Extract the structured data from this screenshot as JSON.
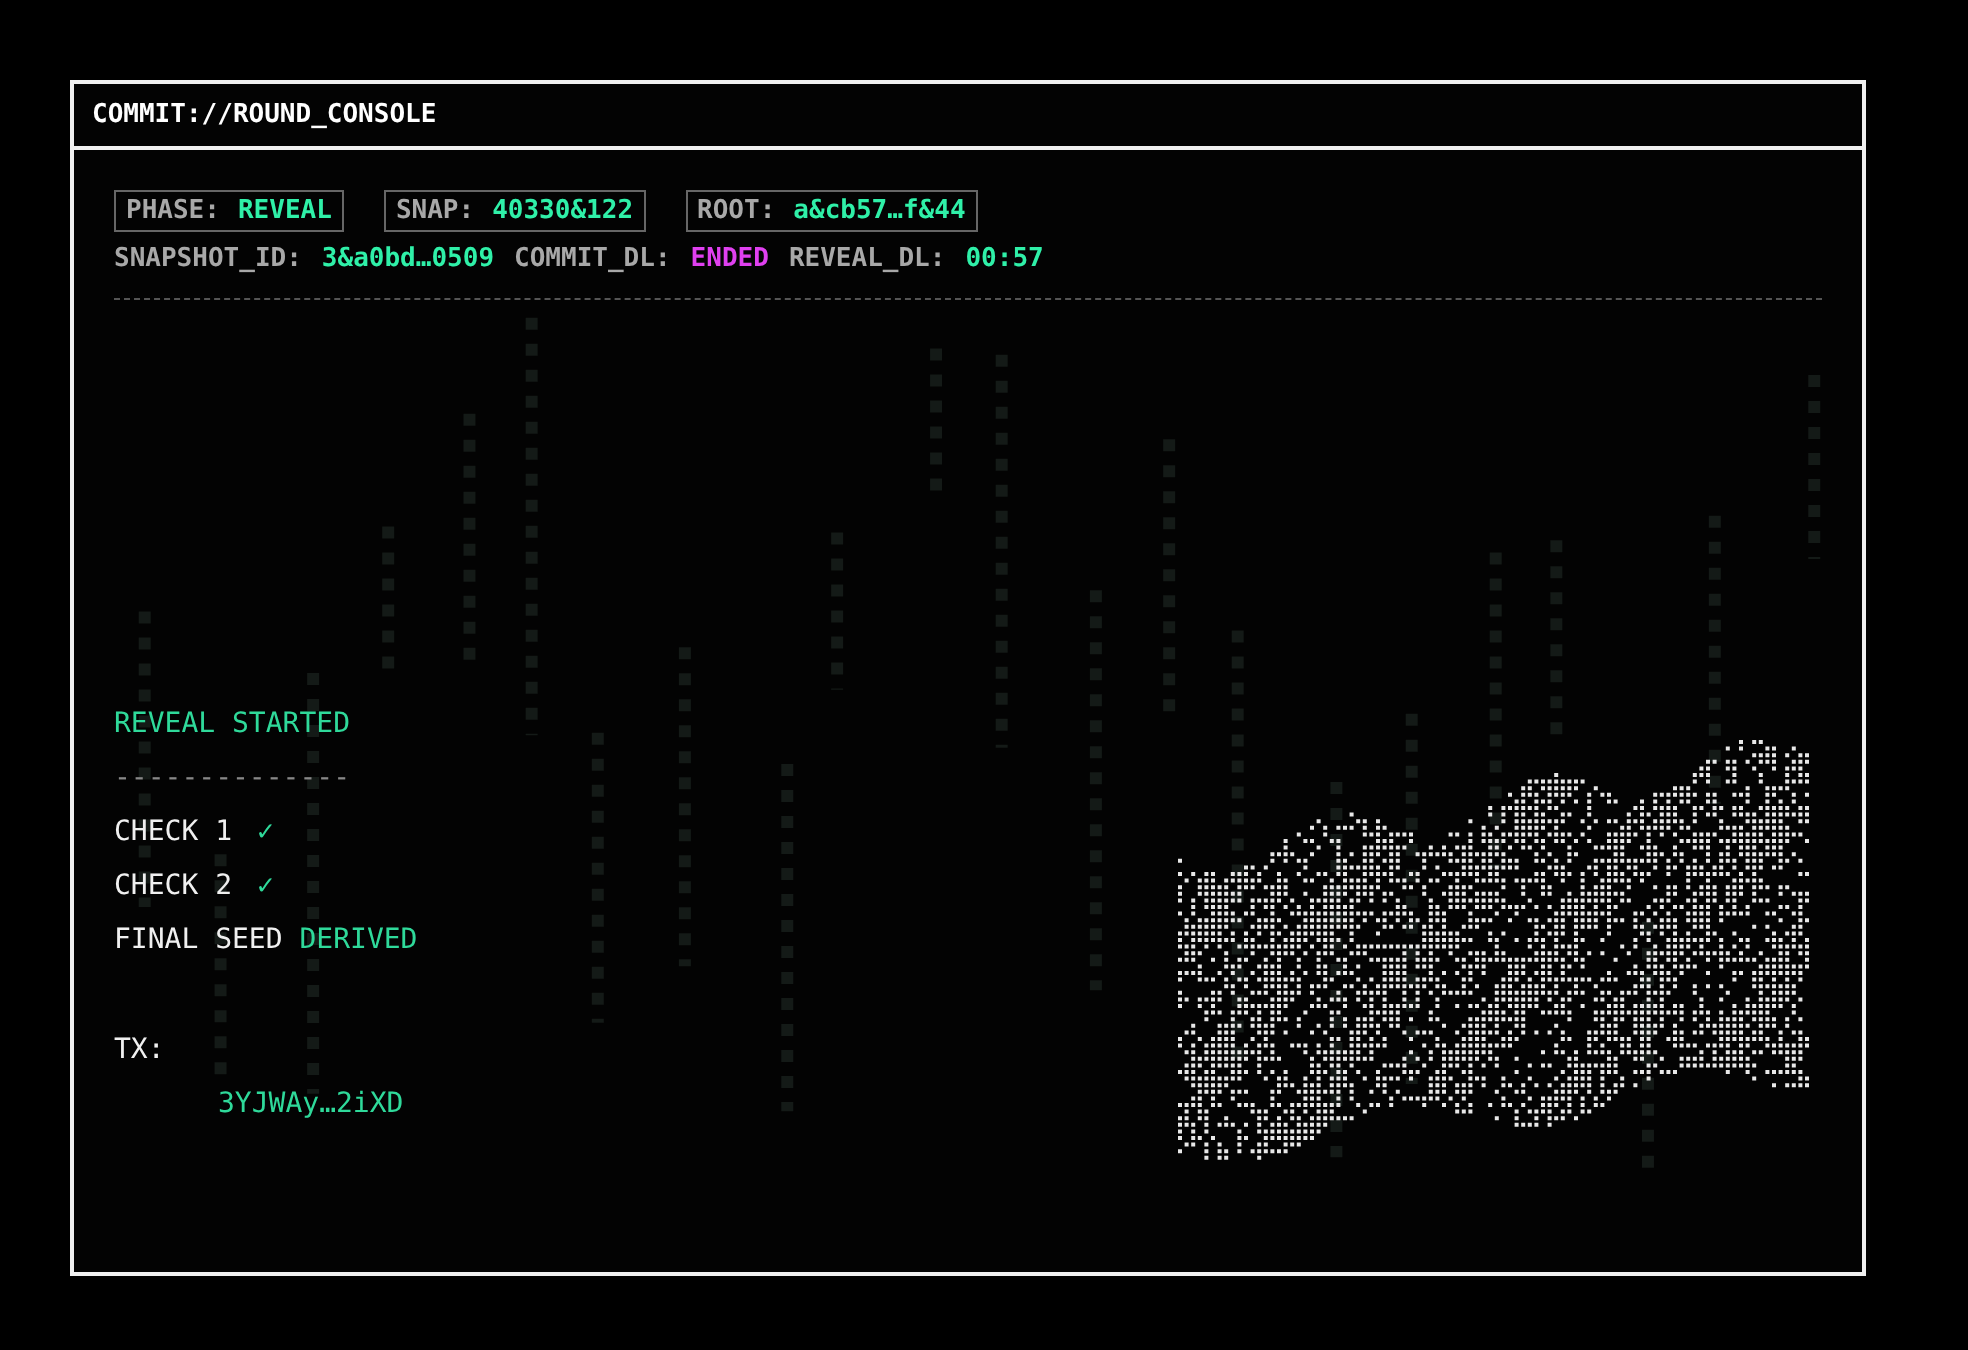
{
  "window": {
    "title": "COMMIT://ROUND_CONSOLE"
  },
  "badges": [
    {
      "label": "PHASE:",
      "value": "REVEAL"
    },
    {
      "label": "SNAP:",
      "value": "40330&122"
    },
    {
      "label": "ROOT:",
      "value": "a&cb57…f&44"
    }
  ],
  "status": [
    {
      "label": "SNAPSHOT_ID:",
      "value": "3&a0bd…0509",
      "kind": "ok"
    },
    {
      "label": "COMMIT_DL:",
      "value": "ENDED",
      "kind": "ended"
    },
    {
      "label": "REVEAL_DL:",
      "value": "00:57",
      "kind": "ok"
    }
  ],
  "log": {
    "heading": "REVEAL STARTED",
    "rule": "--------------",
    "checks": [
      {
        "label": "CHECK 1",
        "mark": "✓"
      },
      {
        "label": "CHECK 2",
        "mark": "✓"
      }
    ],
    "final": {
      "label": "FINAL SEED",
      "value": "DERIVED"
    },
    "tx_label": "TX:",
    "tx": "3YJWAy…2iXD"
  }
}
